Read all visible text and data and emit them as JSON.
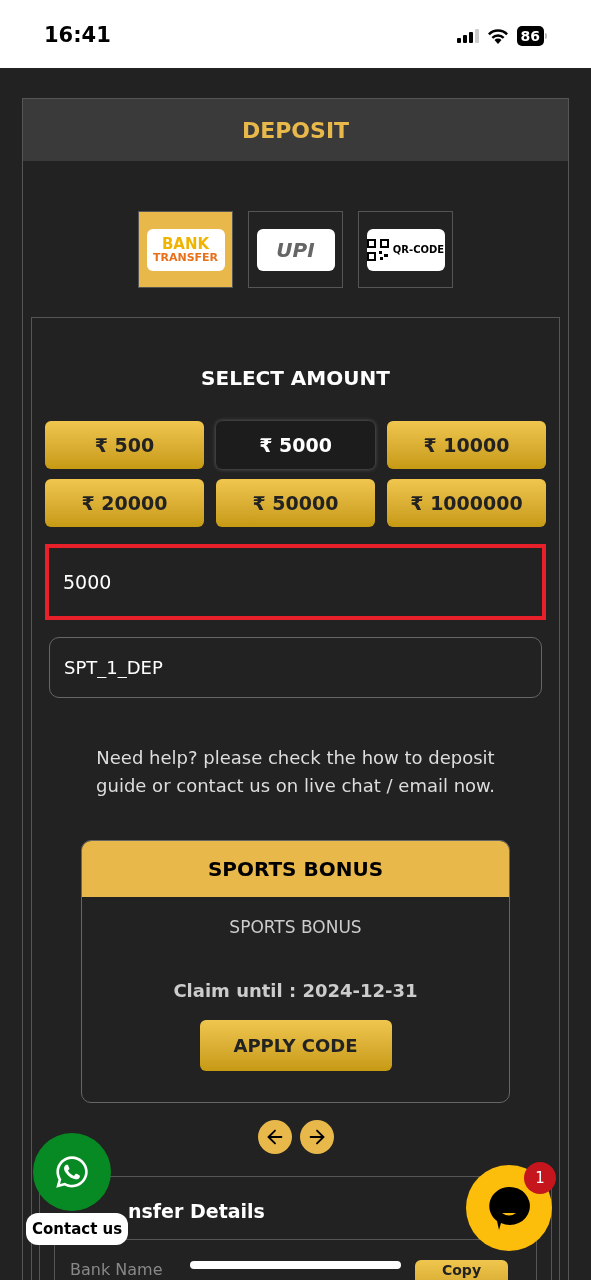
{
  "status_bar": {
    "time": "16:41",
    "battery": "86"
  },
  "title": "DEPOSIT",
  "methods": [
    {
      "kind": "bank",
      "lines": [
        "BANK",
        "TRANSFER"
      ],
      "selected": true
    },
    {
      "kind": "upi",
      "lines": [
        "UPI"
      ],
      "selected": false
    },
    {
      "kind": "qr",
      "lines": [
        "QR-CODE"
      ],
      "selected": false
    }
  ],
  "amount_heading": "SELECT AMOUNT",
  "amounts": [
    {
      "label": "₹ 500",
      "selected": false
    },
    {
      "label": "₹ 5000",
      "selected": true
    },
    {
      "label": "₹ 10000",
      "selected": false
    },
    {
      "label": "₹ 20000",
      "selected": false
    },
    {
      "label": "₹ 50000",
      "selected": false
    },
    {
      "label": "₹ 1000000",
      "selected": false
    }
  ],
  "amount_field": {
    "value": "5000"
  },
  "code_field": {
    "value": "SPT_1_DEP"
  },
  "help": "Need help? please check the how to deposit guide or contact us on live chat / email now.",
  "bonus": {
    "header": "SPORTS BONUS",
    "name": "SPORTS BONUS",
    "claim": "Claim until : 2024-12-31",
    "button": "APPLY CODE"
  },
  "transfer": {
    "title": "nsfer Details",
    "rows": [
      {
        "label": "Bank Name",
        "button": "Copy"
      }
    ]
  },
  "contact": {
    "label": "Contact us"
  },
  "chat": {
    "badge": "1"
  }
}
